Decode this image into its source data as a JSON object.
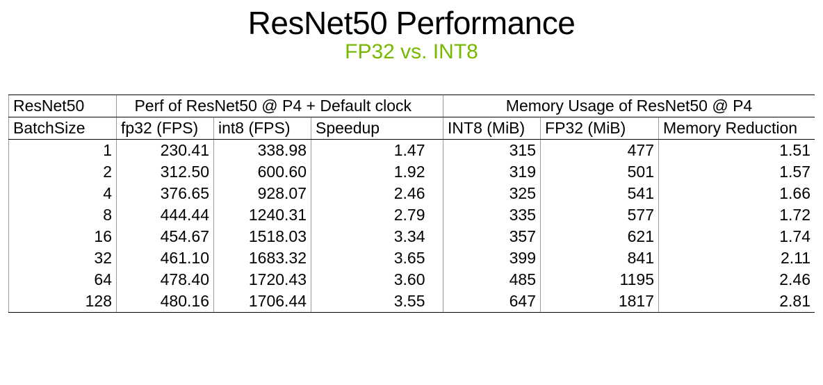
{
  "title": "ResNet50 Performance",
  "subtitle": "FP32 vs. INT8",
  "header": {
    "corner": "ResNet50",
    "group_perf": "Perf of ResNet50 @ P4 + Default clock",
    "group_mem": "Memory Usage of ResNet50 @ P4",
    "col_batch": "BatchSize",
    "col_fp32_fps": "fp32 (FPS)",
    "col_int8_fps": "int8 (FPS)",
    "col_speedup": "Speedup",
    "col_int8_mib": "INT8 (MiB)",
    "col_fp32_mib": "FP32 (MiB)",
    "col_memred": "Memory Reduction"
  },
  "rows": [
    {
      "batch": "1",
      "fp32_fps": "230.41",
      "int8_fps": "338.98",
      "speedup": "1.47",
      "int8_mib": "315",
      "fp32_mib": "477",
      "memred": "1.51"
    },
    {
      "batch": "2",
      "fp32_fps": "312.50",
      "int8_fps": "600.60",
      "speedup": "1.92",
      "int8_mib": "319",
      "fp32_mib": "501",
      "memred": "1.57"
    },
    {
      "batch": "4",
      "fp32_fps": "376.65",
      "int8_fps": "928.07",
      "speedup": "2.46",
      "int8_mib": "325",
      "fp32_mib": "541",
      "memred": "1.66"
    },
    {
      "batch": "8",
      "fp32_fps": "444.44",
      "int8_fps": "1240.31",
      "speedup": "2.79",
      "int8_mib": "335",
      "fp32_mib": "577",
      "memred": "1.72"
    },
    {
      "batch": "16",
      "fp32_fps": "454.67",
      "int8_fps": "1518.03",
      "speedup": "3.34",
      "int8_mib": "357",
      "fp32_mib": "621",
      "memred": "1.74"
    },
    {
      "batch": "32",
      "fp32_fps": "461.10",
      "int8_fps": "1683.32",
      "speedup": "3.65",
      "int8_mib": "399",
      "fp32_mib": "841",
      "memred": "2.11"
    },
    {
      "batch": "64",
      "fp32_fps": "478.40",
      "int8_fps": "1720.43",
      "speedup": "3.60",
      "int8_mib": "485",
      "fp32_mib": "1195",
      "memred": "2.46"
    },
    {
      "batch": "128",
      "fp32_fps": "480.16",
      "int8_fps": "1706.44",
      "speedup": "3.55",
      "int8_mib": "647",
      "fp32_mib": "1817",
      "memred": "2.81"
    }
  ],
  "chart_data": {
    "type": "table",
    "title": "ResNet50 Performance — FP32 vs. INT8",
    "columns": [
      "BatchSize",
      "fp32 (FPS)",
      "int8 (FPS)",
      "Speedup",
      "INT8 (MiB)",
      "FP32 (MiB)",
      "Memory Reduction"
    ],
    "x": [
      1,
      2,
      4,
      8,
      16,
      32,
      64,
      128
    ],
    "series": [
      {
        "name": "fp32 (FPS)",
        "values": [
          230.41,
          312.5,
          376.65,
          444.44,
          454.67,
          461.1,
          478.4,
          480.16
        ]
      },
      {
        "name": "int8 (FPS)",
        "values": [
          338.98,
          600.6,
          928.07,
          1240.31,
          1518.03,
          1683.32,
          1720.43,
          1706.44
        ]
      },
      {
        "name": "Speedup",
        "values": [
          1.47,
          1.92,
          2.46,
          2.79,
          3.34,
          3.65,
          3.6,
          3.55
        ]
      },
      {
        "name": "INT8 (MiB)",
        "values": [
          315,
          319,
          325,
          335,
          357,
          399,
          485,
          647
        ]
      },
      {
        "name": "FP32 (MiB)",
        "values": [
          477,
          501,
          541,
          577,
          621,
          841,
          1195,
          1817
        ]
      },
      {
        "name": "Memory Reduction",
        "values": [
          1.51,
          1.57,
          1.66,
          1.72,
          1.74,
          2.11,
          2.46,
          2.81
        ]
      }
    ],
    "groups": [
      {
        "name": "Perf of ResNet50 @ P4 + Default clock",
        "cols": [
          "fp32 (FPS)",
          "int8 (FPS)",
          "Speedup"
        ]
      },
      {
        "name": "Memory Usage of ResNet50 @ P4",
        "cols": [
          "INT8 (MiB)",
          "FP32 (MiB)",
          "Memory Reduction"
        ]
      }
    ]
  },
  "watermark": ""
}
